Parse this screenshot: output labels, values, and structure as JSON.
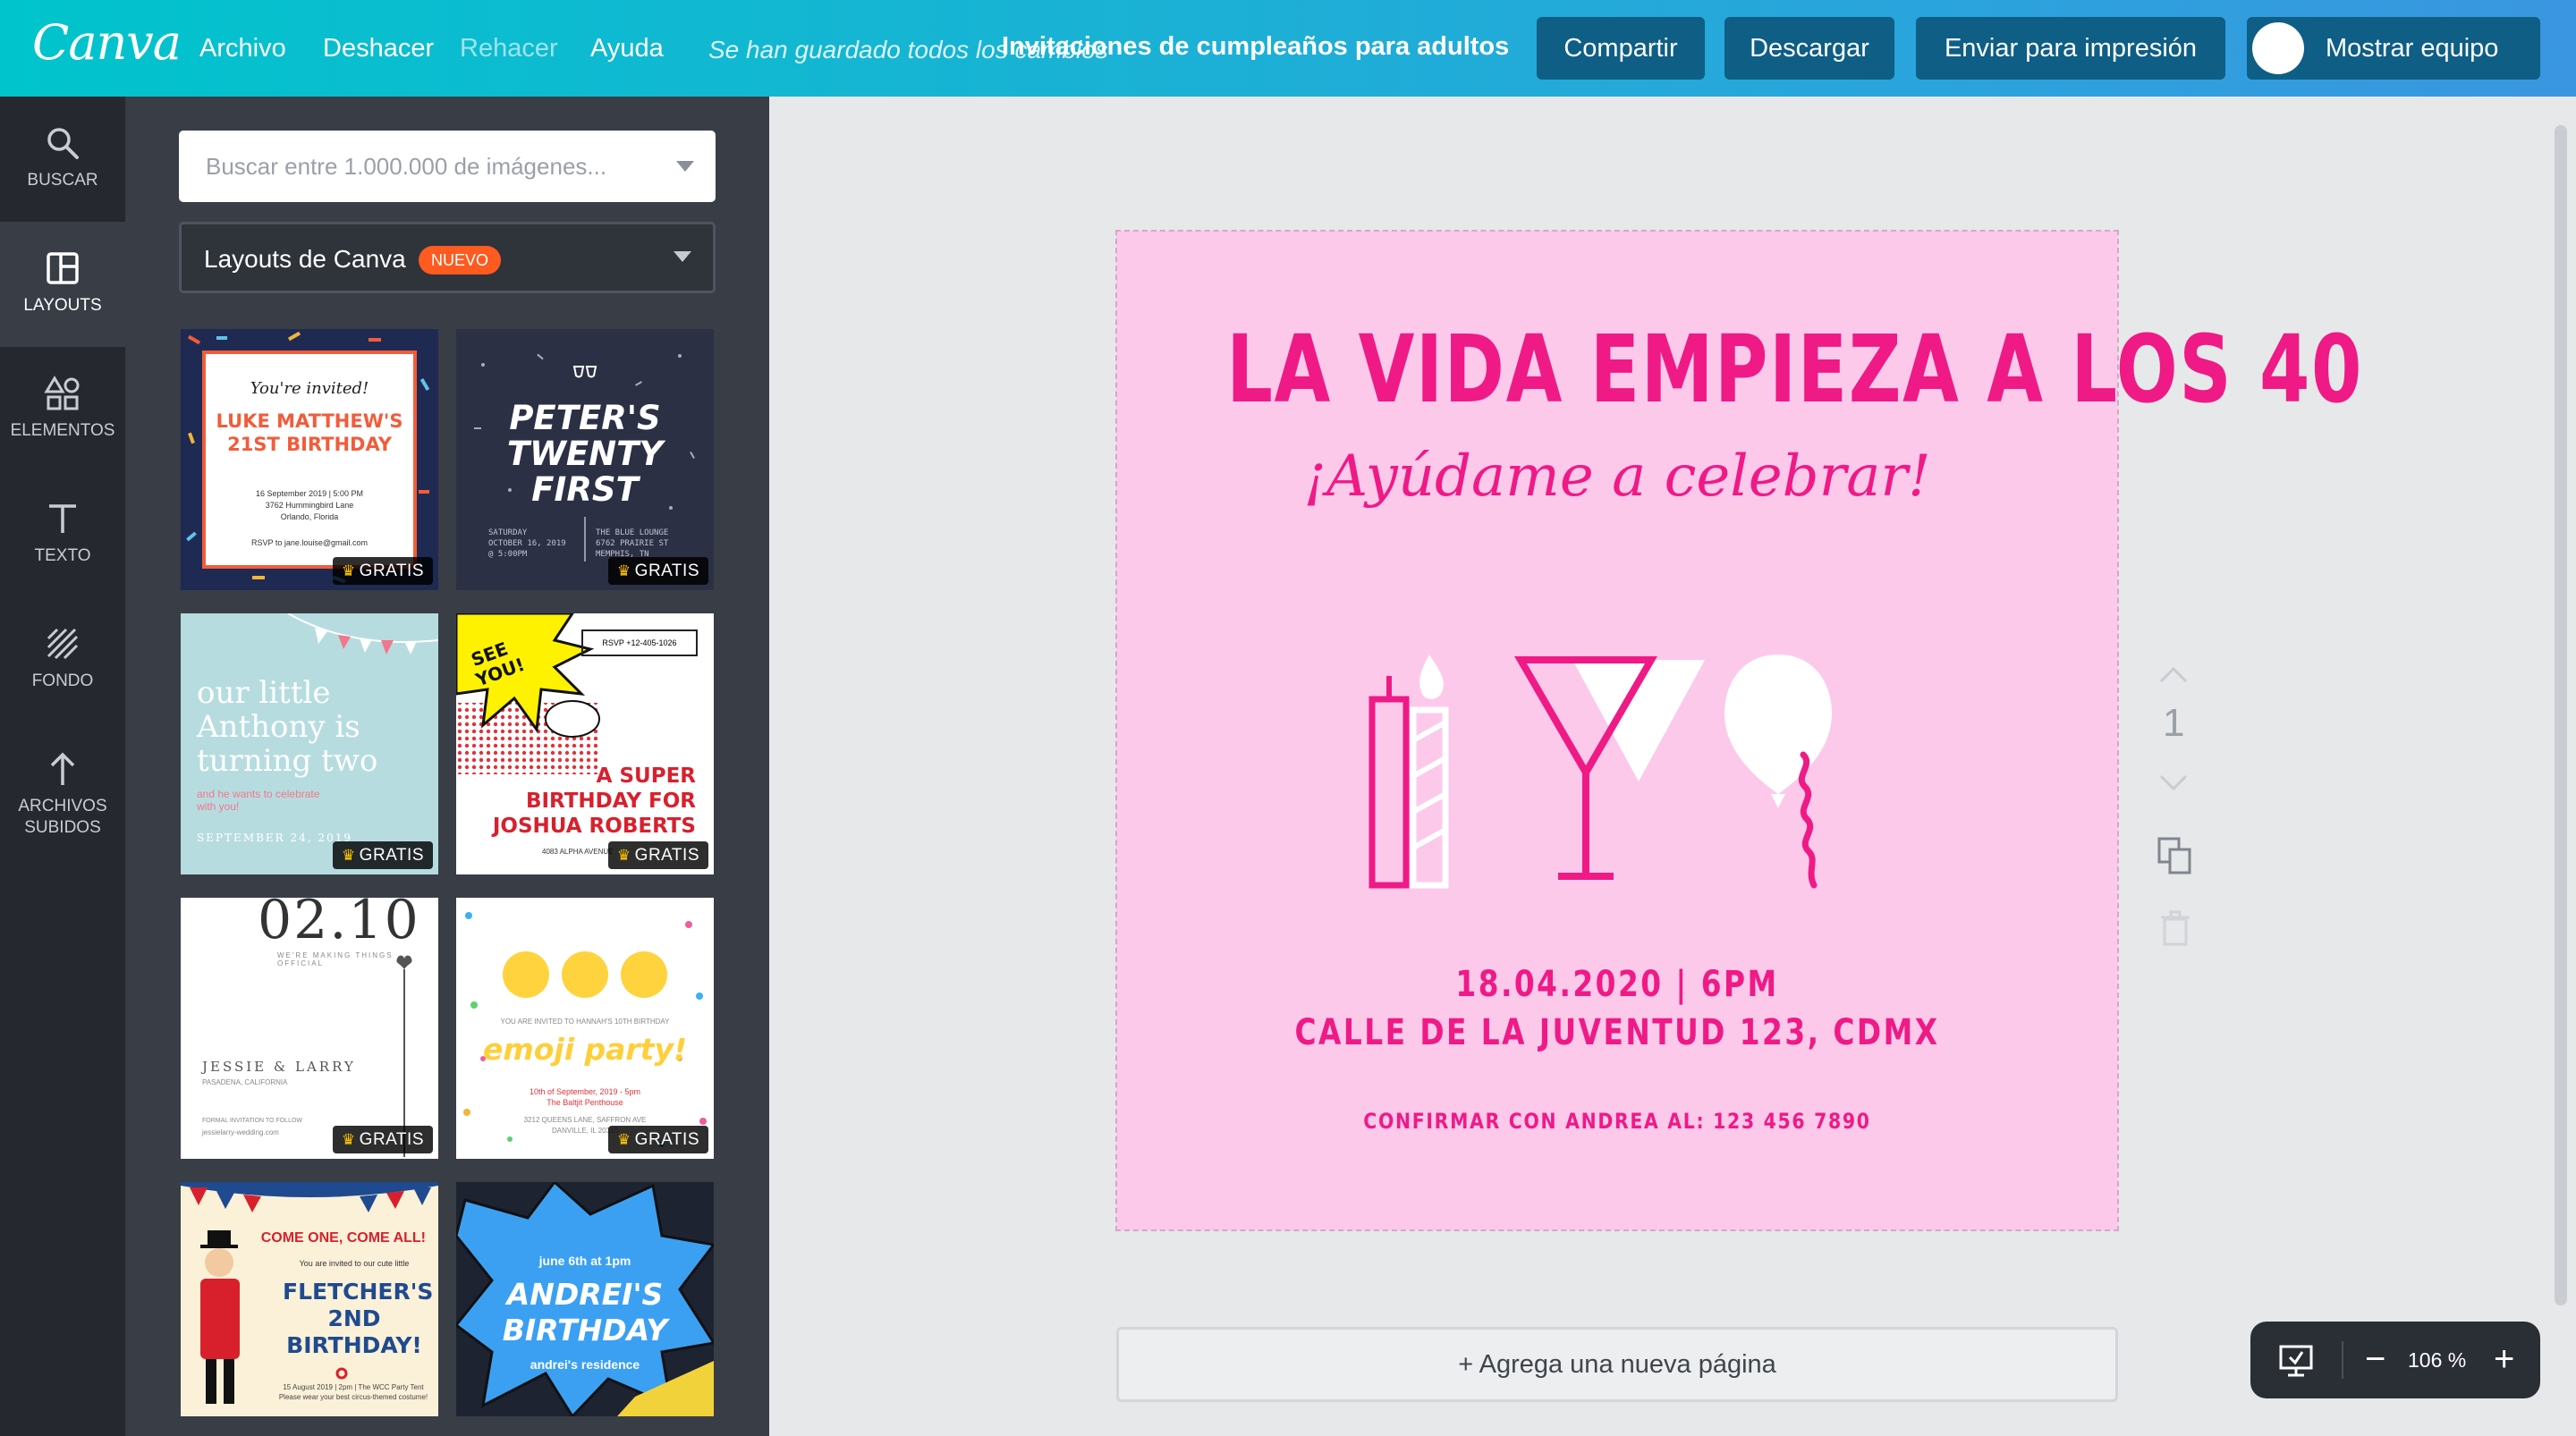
{
  "topbar": {
    "logo": "Canva",
    "menu": [
      "Archivo",
      "Deshacer",
      "Rehacer",
      "Ayuda"
    ],
    "saved_status": "Se han guardado todos los cambios",
    "document_title": "Invitaciones de cumpleaños para adultos",
    "share": "Compartir",
    "download": "Descargar",
    "print": "Enviar para impresión",
    "team": "Mostrar equipo"
  },
  "rail": {
    "items": [
      {
        "label": "BUSCAR",
        "icon": "search-icon"
      },
      {
        "label": "LAYOUTS",
        "icon": "layouts-icon"
      },
      {
        "label": "ELEMENTOS",
        "icon": "shapes-icon"
      },
      {
        "label": "TEXTO",
        "icon": "text-icon"
      },
      {
        "label": "FONDO",
        "icon": "background-icon"
      },
      {
        "label": "ARCHIVOS",
        "label2": "SUBIDOS",
        "icon": "upload-icon"
      }
    ]
  },
  "panel": {
    "search_placeholder": "Buscar entre 1.000.000 de imágenes...",
    "layouts_label": "Layouts de Canva",
    "nuevo_badge": "NUEVO",
    "badge": "GRATIS",
    "thumbs": {
      "t1": {
        "invited": "You're invited!",
        "name1": "LUKE MATTHEW'S",
        "name2": "21ST BIRTHDAY",
        "d1": "16 September 2019 | 5:00 PM",
        "d2": "3762 Hummingbird Lane",
        "d3": "Orlando, Florida",
        "rsvp": "RSVP to jane.louise@gmail.com"
      },
      "t2": {
        "l1": "PETER'S",
        "l2": "TWENTY",
        "l3": "FIRST",
        "left1": "SATURDAY",
        "left2": "OCTOBER 16, 2019",
        "left3": "@ 5:00PM",
        "right1": "THE BLUE LOUNGE",
        "right2": "6762 PRAIRIE ST",
        "right3": "MEMPHIS, TN"
      },
      "t3": {
        "l1": "our little",
        "l2": "Anthony is",
        "l3": "turning two",
        "s1": "and he wants to celebrate",
        "s2": "with you!",
        "date": "SEPTEMBER 24, 2019"
      },
      "t4": {
        "see": "SEE",
        "you": "YOU!",
        "rsvp": "RSVP +12-405-1026",
        "l1": "A SUPER",
        "l2": "BIRTHDAY FOR",
        "l3": "JOSHUA ROBERTS",
        "addr": "4083 ALPHA AVENUE"
      },
      "t5": {
        "date": "02.10",
        "tag": "WE'RE MAKING THINGS OFFICIAL",
        "names": "JESSIE & LARRY",
        "city": "PASADENA, CALIFORNIA",
        "follow": "FORMAL INVITATION TO FOLLOW",
        "site": "jessielarry-wedding.com"
      },
      "t6": {
        "invite": "YOU ARE INVITED TO HANNAH'S 10TH BIRTHDAY",
        "title": "emoji party!",
        "d1": "10th of September, 2019 - 5pm",
        "d2": "The Baltjit Penthouse",
        "d3": "3212 QUEENS LANE, SAFFRON AVE",
        "d4": "DANVILLE, IL 20310"
      },
      "t7": {
        "come": "COME ONE, COME ALL!",
        "invited": "You are invited to our cute little",
        "l1": "FLETCHER'S",
        "l2": "2ND BIRTHDAY!",
        "d1": "15 August 2019 | 2pm | The WCC Party Tent",
        "d2": "Please wear your best circus-themed costume!"
      },
      "t8": {
        "when": "june 6th at 1pm",
        "l1": "ANDREI'S",
        "l2": "BIRTHDAY",
        "place": "andrei's residence"
      }
    }
  },
  "design": {
    "title": "LA VIDA EMPIEZA A LOS 40",
    "subtitle": "¡Ayúdame a celebrar!",
    "date_line": "18.04.2020 | 6PM",
    "address": "CALLE DE LA JUVENTUD 123, CDMX",
    "rsvp": "CONFIRMAR CON ANDREA AL: 123 456 7890",
    "accent": "#ef1a86",
    "background": "#fcc9eb"
  },
  "page_number": "1",
  "add_page": "+ Agrega una nueva página",
  "zoom": {
    "value": "106 %",
    "minus": "−",
    "plus": "+"
  }
}
